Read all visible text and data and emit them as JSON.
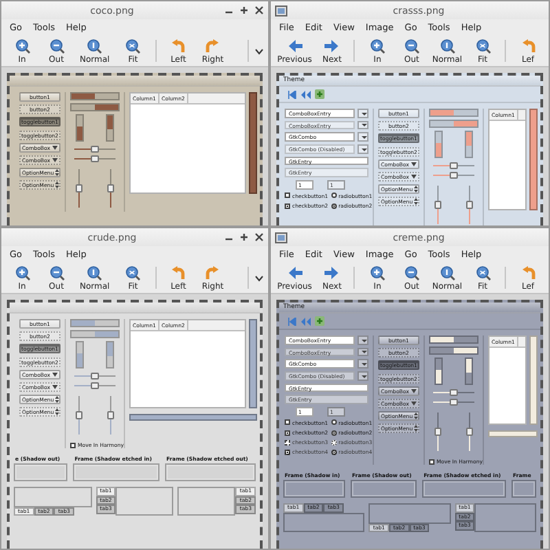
{
  "windows": [
    {
      "title": "coco.png",
      "icon_visible": false,
      "controls_visible": true,
      "menus": [
        "Go",
        "Tools",
        "Help"
      ],
      "overflow": true,
      "toolbar": [
        {
          "kind": "zoom-in",
          "label": "In"
        },
        {
          "kind": "zoom-out",
          "label": "Out"
        },
        {
          "kind": "zoom-normal",
          "label": "Normal"
        },
        {
          "kind": "zoom-fit",
          "label": "Fit"
        },
        {
          "kind": "rotate-left",
          "label": "Left"
        },
        {
          "kind": "rotate-right",
          "label": "Right"
        }
      ],
      "preview": {
        "color": "#cbc3b2",
        "accent": {
          "color": "#8e5a43"
        },
        "icon_bar": false,
        "columns": [
          {
            "kind": "buttons",
            "items": [
              {
                "kind": "button",
                "text": "button1",
                "disabled": false
              },
              {
                "kind": "button",
                "text": "button2",
                "disabled": true
              },
              {
                "kind": "toggle",
                "text": "togglebutton1",
                "disabled": false,
                "on": true
              },
              {
                "kind": "toggle",
                "text": "togglebutton2",
                "disabled": true,
                "on": false
              },
              {
                "kind": "combo",
                "text": "ComboBox",
                "disabled": false
              },
              {
                "kind": "combo",
                "text": "ComboBox",
                "disabled": true
              },
              {
                "kind": "option",
                "text": "OptionMenu",
                "disabled": false
              },
              {
                "kind": "option",
                "text": "OptionMenu",
                "disabled": true
              }
            ]
          },
          {
            "kind": "ranges",
            "hbars": [
              {
                "level": 0.5,
                "inverted": false
              },
              {
                "level": 0.5,
                "inverted": true
              }
            ],
            "vbars": [
              {
                "level": 0.55,
                "inverted": false
              },
              {
                "level": 0.55,
                "inverted": true
              }
            ],
            "hscales": [
              {
                "level": 0.5
              },
              {
                "level": 0.5
              }
            ],
            "vscales": [
              {
                "level": 0.5
              },
              {
                "level": 0.5
              }
            ]
          },
          {
            "kind": "tree",
            "headers": [
              "Column1",
              "Column2"
            ],
            "hscroll": false
          }
        ]
      }
    },
    {
      "title": "crasss.png",
      "icon_visible": true,
      "controls_visible": false,
      "menus": [
        "File",
        "Edit",
        "View",
        "Image",
        "Go",
        "Tools",
        "Help"
      ],
      "overflow": false,
      "toolbar": [
        {
          "kind": "prev",
          "label": "Previous"
        },
        {
          "kind": "next",
          "label": "Next"
        },
        {
          "kind": "zoom-in",
          "label": "In"
        },
        {
          "kind": "zoom-out",
          "label": "Out"
        },
        {
          "kind": "zoom-normal",
          "label": "Normal"
        },
        {
          "kind": "zoom-fit",
          "label": "Fit"
        },
        {
          "kind": "rotate-left",
          "label": "Lef"
        }
      ],
      "preview": {
        "title": "Theme",
        "color": "#d5dee9",
        "accent": {
          "color": "#ee9f8c"
        },
        "icon_bar": true,
        "columns": [
          {
            "kind": "entries",
            "items": [
              {
                "kind": "combo-entry",
                "text": "ComboBoxEntry",
                "disabled": false
              },
              {
                "kind": "combo-entry",
                "text": "ComboBoxEntry",
                "disabled": true
              },
              {
                "kind": "combo-entry",
                "text": "GtkCombo",
                "disabled": false
              },
              {
                "kind": "combo-entry",
                "text": "GtkCombo (Disabled)",
                "disabled": true
              },
              {
                "kind": "entry",
                "text": "GtkEntry",
                "disabled": false
              },
              {
                "kind": "entry",
                "text": "GtkEntry",
                "disabled": true
              },
              {
                "kind": "spins",
                "values": [
                  {
                    "text": "1",
                    "disabled": false
                  },
                  {
                    "text": "1",
                    "disabled": true
                  }
                ]
              },
              {
                "kind": "checks",
                "check": {
                  "text": "checkbutton1",
                  "checked": false,
                  "disabled": false
                },
                "radio": {
                  "text": "radiobutton1",
                  "selected": false,
                  "disabled": false
                }
              },
              {
                "kind": "checks",
                "check": {
                  "text": "checkbutton2",
                  "checked": true,
                  "disabled": false
                },
                "radio": {
                  "text": "radiobutton2",
                  "selected": true,
                  "disabled": false
                }
              }
            ]
          },
          {
            "kind": "buttons",
            "items": [
              {
                "kind": "button",
                "text": "button1",
                "disabled": false
              },
              {
                "kind": "button",
                "text": "button2",
                "disabled": true
              },
              {
                "kind": "toggle",
                "text": "togglebutton1",
                "disabled": false,
                "on": true
              },
              {
                "kind": "toggle",
                "text": "togglebutton2",
                "disabled": true,
                "on": false
              },
              {
                "kind": "combo",
                "text": "ComboBox",
                "disabled": false
              },
              {
                "kind": "combo",
                "text": "ComboBox",
                "disabled": true
              },
              {
                "kind": "option",
                "text": "OptionMenu",
                "disabled": false
              },
              {
                "kind": "option",
                "text": "OptionMenu",
                "disabled": true
              }
            ]
          },
          {
            "kind": "ranges",
            "hbars": [
              {
                "level": 0.5,
                "inverted": false
              },
              {
                "level": 0.5,
                "inverted": true
              }
            ],
            "vbars": [
              {
                "level": 0.55,
                "inverted": false
              },
              {
                "level": 0.55,
                "inverted": true
              }
            ],
            "hscales": [
              {
                "level": 0.5
              },
              {
                "level": 0.5
              }
            ],
            "vscales": [
              {
                "level": 0.5
              },
              {
                "level": 0.5
              }
            ]
          },
          {
            "kind": "tree",
            "headers": [
              "Column1"
            ],
            "hscroll": false
          }
        ]
      }
    },
    {
      "title": "crude.png",
      "icon_visible": false,
      "controls_visible": true,
      "menus": [
        "Go",
        "Tools",
        "Help"
      ],
      "overflow": true,
      "toolbar": [
        {
          "kind": "zoom-in",
          "label": "In"
        },
        {
          "kind": "zoom-out",
          "label": "Out"
        },
        {
          "kind": "zoom-normal",
          "label": "Normal"
        },
        {
          "kind": "zoom-fit",
          "label": "Fit"
        },
        {
          "kind": "rotate-left",
          "label": "Left"
        },
        {
          "kind": "rotate-right",
          "label": "Right"
        }
      ],
      "preview": {
        "color": "#dedede",
        "accent": {
          "color": "#a3afc6"
        },
        "icon_bar": false,
        "columns": [
          {
            "kind": "buttons",
            "items": [
              {
                "kind": "button",
                "text": "button1",
                "disabled": false
              },
              {
                "kind": "button",
                "text": "button2",
                "disabled": true
              },
              {
                "kind": "toggle",
                "text": "togglebutton1",
                "disabled": false,
                "on": true
              },
              {
                "kind": "toggle",
                "text": "togglebutton2",
                "disabled": true,
                "on": false
              },
              {
                "kind": "combo",
                "text": "ComboBox",
                "disabled": false
              },
              {
                "kind": "combo",
                "text": "ComboBox",
                "disabled": true
              },
              {
                "kind": "option",
                "text": "OptionMenu",
                "disabled": false
              },
              {
                "kind": "option",
                "text": "OptionMenu",
                "disabled": true
              }
            ]
          },
          {
            "kind": "ranges",
            "hbars": [
              {
                "level": 0.5,
                "inverted": false
              },
              {
                "level": 0.5,
                "inverted": true
              }
            ],
            "vbars": [
              {
                "level": 0.55,
                "inverted": false
              },
              {
                "level": 0.55,
                "inverted": true
              }
            ],
            "hscales": [
              {
                "level": 0.5
              },
              {
                "level": 0.5
              }
            ],
            "vscales": [
              {
                "level": 0.5
              },
              {
                "level": 0.5
              }
            ],
            "harmony": {
              "text": "Move In Harmony",
              "checked": false
            }
          },
          {
            "kind": "tree",
            "headers": [
              "Column1",
              "Column2"
            ],
            "hscroll": true
          }
        ],
        "frames": [
          "e (Shadow out)",
          "Frame (Shadow etched in)",
          "Frame (Shadow etched out)"
        ],
        "notebooks": [
          {
            "kind": "bottom",
            "tabs": [
              {
                "label": "tab1",
                "selected": true
              },
              {
                "label": "tab2",
                "selected": false
              },
              {
                "label": "tab3",
                "selected": false
              }
            ]
          },
          {
            "kind": "left",
            "tabs": [
              {
                "label": "tab1",
                "selected": true
              },
              {
                "label": "tab2",
                "selected": false
              },
              {
                "label": "tab3",
                "selected": false
              }
            ]
          },
          {
            "kind": "right",
            "tabs": [
              {
                "label": "tab1",
                "selected": true
              },
              {
                "label": "tab2",
                "selected": false
              },
              {
                "label": "tab3",
                "selected": false
              }
            ]
          }
        ]
      }
    },
    {
      "title": "creme.png",
      "icon_visible": true,
      "controls_visible": false,
      "menus": [
        "File",
        "Edit",
        "View",
        "Image",
        "Go",
        "Tools",
        "Help"
      ],
      "overflow": false,
      "toolbar": [
        {
          "kind": "prev",
          "label": "Previous"
        },
        {
          "kind": "next",
          "label": "Next"
        },
        {
          "kind": "zoom-in",
          "label": "In"
        },
        {
          "kind": "zoom-out",
          "label": "Out"
        },
        {
          "kind": "zoom-normal",
          "label": "Normal"
        },
        {
          "kind": "zoom-fit",
          "label": "Fit"
        },
        {
          "kind": "rotate-left",
          "label": "Lef"
        }
      ],
      "preview": {
        "title": "Theme",
        "color": "#9da2b3",
        "accent": {
          "color": "#f2ecdf"
        },
        "icon_bar": true,
        "columns": [
          {
            "kind": "entries",
            "items": [
              {
                "kind": "combo-entry",
                "text": "ComboBoxEntry",
                "disabled": false
              },
              {
                "kind": "combo-entry",
                "text": "ComboBoxEntry",
                "disabled": true
              },
              {
                "kind": "combo-entry",
                "text": "GtkCombo",
                "disabled": false
              },
              {
                "kind": "combo-entry",
                "text": "GtkCombo (Disabled)",
                "disabled": true
              },
              {
                "kind": "entry",
                "text": "GtkEntry",
                "disabled": false
              },
              {
                "kind": "entry",
                "text": "GtkEntry",
                "disabled": true
              },
              {
                "kind": "spins",
                "values": [
                  {
                    "text": "1",
                    "disabled": false
                  },
                  {
                    "text": "1",
                    "disabled": true
                  }
                ]
              },
              {
                "kind": "checks",
                "check": {
                  "text": "checkbutton1",
                  "checked": false,
                  "disabled": false
                },
                "radio": {
                  "text": "radiobutton1",
                  "selected": false,
                  "disabled": false
                }
              },
              {
                "kind": "checks",
                "check": {
                  "text": "checkbutton2",
                  "checked": true,
                  "disabled": false
                },
                "radio": {
                  "text": "radiobutton2",
                  "selected": true,
                  "disabled": false
                }
              },
              {
                "kind": "checks",
                "check": {
                  "text": "checkbutton3",
                  "checked": false,
                  "disabled": true
                },
                "radio": {
                  "text": "radiobutton3",
                  "selected": false,
                  "disabled": true
                }
              },
              {
                "kind": "checks",
                "check": {
                  "text": "checkbutton4",
                  "checked": true,
                  "disabled": true
                },
                "radio": {
                  "text": "radiobutton4",
                  "selected": true,
                  "disabled": true
                }
              }
            ]
          },
          {
            "kind": "buttons",
            "items": [
              {
                "kind": "button",
                "text": "button1",
                "disabled": false
              },
              {
                "kind": "button",
                "text": "button2",
                "disabled": true
              },
              {
                "kind": "toggle",
                "text": "togglebutton1",
                "disabled": false,
                "on": true
              },
              {
                "kind": "toggle",
                "text": "togglebutton2",
                "disabled": true,
                "on": false
              },
              {
                "kind": "combo",
                "text": "ComboBox",
                "disabled": false
              },
              {
                "kind": "combo",
                "text": "ComboBox",
                "disabled": true
              },
              {
                "kind": "option",
                "text": "OptionMenu",
                "disabled": false
              },
              {
                "kind": "option",
                "text": "OptionMenu",
                "disabled": true
              }
            ]
          },
          {
            "kind": "ranges",
            "hbars": [
              {
                "level": 0.5,
                "inverted": false
              },
              {
                "level": 0.5,
                "inverted": true
              }
            ],
            "vbars": [
              {
                "level": 0.55,
                "inverted": false
              },
              {
                "level": 0.55,
                "inverted": true
              }
            ],
            "hscales": [
              {
                "level": 0.5
              },
              {
                "level": 0.5
              }
            ],
            "vscales": [
              {
                "level": 0.5
              },
              {
                "level": 0.5
              }
            ],
            "harmony": {
              "text": "Move In Harmony",
              "checked": false
            }
          },
          {
            "kind": "tree",
            "headers": [
              "Column1"
            ],
            "hscroll": true
          }
        ],
        "frames": [
          "Frame (Shadow in)",
          "Frame (Shadow out)",
          "Frame (Shadow etched in)",
          "Frame"
        ],
        "notebooks": [
          {
            "kind": "top",
            "tabs": [
              {
                "label": "tab1",
                "selected": true
              },
              {
                "label": "tab2",
                "selected": false
              },
              {
                "label": "tab3",
                "selected": false
              }
            ]
          },
          {
            "kind": "bottom",
            "tabs": [
              {
                "label": "tab1",
                "selected": true
              },
              {
                "label": "tab2",
                "selected": false
              },
              {
                "label": "tab3",
                "selected": false
              }
            ]
          },
          {
            "kind": "left",
            "tabs": [
              {
                "label": "tab1",
                "selected": true
              },
              {
                "label": "tab2",
                "selected": false
              },
              {
                "label": "tab3",
                "selected": false
              }
            ]
          }
        ]
      }
    }
  ]
}
